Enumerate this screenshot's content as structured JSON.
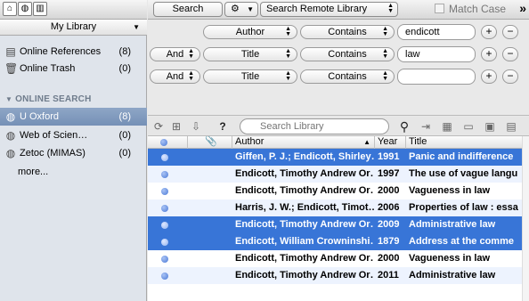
{
  "sidebar": {
    "top_icons": [
      "home-icon",
      "globe-icon",
      "library-icon"
    ],
    "library_label": "My Library",
    "items": [
      {
        "label": "Online References",
        "count": "(8)",
        "icon": "references-icon"
      },
      {
        "label": "Online Trash",
        "count": "(0)",
        "icon": "trash-icon"
      }
    ],
    "section_title": "ONLINE SEARCH",
    "search_items": [
      {
        "label": "U Oxford",
        "count": "(8)",
        "selected": true
      },
      {
        "label": "Web of Scien…",
        "count": "(0)",
        "selected": false
      },
      {
        "label": "Zetoc (MIMAS)",
        "count": "(0)",
        "selected": false
      }
    ],
    "more_label": "more..."
  },
  "toolbar": {
    "search_label": "Search",
    "remote_library": "Search Remote Library",
    "match_case": "Match Case",
    "overflow": "»"
  },
  "query": {
    "rows": [
      {
        "bool": "",
        "field": "Author",
        "op": "Contains",
        "value": ""
      },
      {
        "bool": "And",
        "field": "Title",
        "op": "Contains",
        "value": "law"
      },
      {
        "bool": "And",
        "field": "Title",
        "op": "Contains",
        "value": ""
      }
    ],
    "first_value": "endicott",
    "add": "+",
    "remove": "−"
  },
  "items_toolbar": {
    "search_placeholder": "Search Library",
    "help": "?"
  },
  "table": {
    "columns": [
      "Author",
      "Year",
      "Title"
    ],
    "rows": [
      {
        "author": "Giffen, P. J.; Endicott, Shirley…",
        "year": "1991",
        "title": "Panic and indifference",
        "selected": true
      },
      {
        "author": "Endicott, Timothy Andrew Or…",
        "year": "1997",
        "title": "The use of vague langu",
        "selected": false
      },
      {
        "author": "Endicott, Timothy Andrew Or…",
        "year": "2000",
        "title": "Vagueness in law",
        "selected": false
      },
      {
        "author": "Harris, J. W.; Endicott, Timot…",
        "year": "2006",
        "title": "Properties of law : essa",
        "selected": false
      },
      {
        "author": "Endicott, Timothy Andrew Or…",
        "year": "2009",
        "title": "Administrative law",
        "selected": true
      },
      {
        "author": "Endicott, William Crowninshi…",
        "year": "1879",
        "title": "Address at the comme",
        "selected": true
      },
      {
        "author": "Endicott, Timothy Andrew Or…",
        "year": "2000",
        "title": "Vagueness in law",
        "selected": false
      },
      {
        "author": "Endicott, Timothy Andrew Or…",
        "year": "2011",
        "title": "Administrative law",
        "selected": false
      }
    ]
  }
}
